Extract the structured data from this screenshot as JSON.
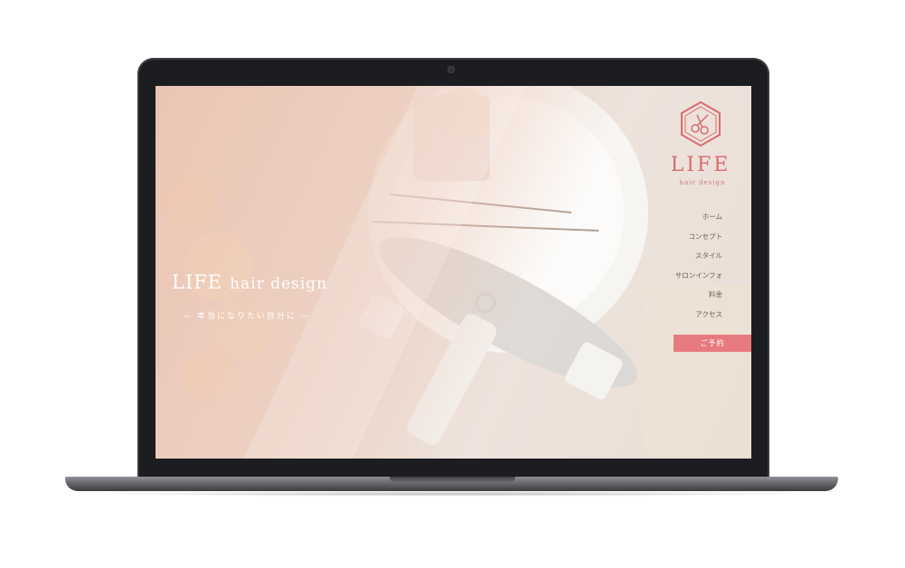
{
  "hero": {
    "title_main": "LIFE",
    "title_rest": "hair design",
    "subtitle": "— 本当になりたい自分に —"
  },
  "logo": {
    "name": "LIFE",
    "tagline": "hair design",
    "icon": "scissors-hexagon-icon"
  },
  "nav": {
    "items": [
      {
        "label": "ホーム"
      },
      {
        "label": "コンセプト"
      },
      {
        "label": "スタイル"
      },
      {
        "label": "サロンインフォ"
      },
      {
        "label": "料金"
      },
      {
        "label": "アクセス"
      }
    ]
  },
  "reserve": {
    "label": "ご予約"
  },
  "colors": {
    "accent": "#e77981",
    "logo": "#d86b6f",
    "overlay": "#ebbeaa"
  }
}
